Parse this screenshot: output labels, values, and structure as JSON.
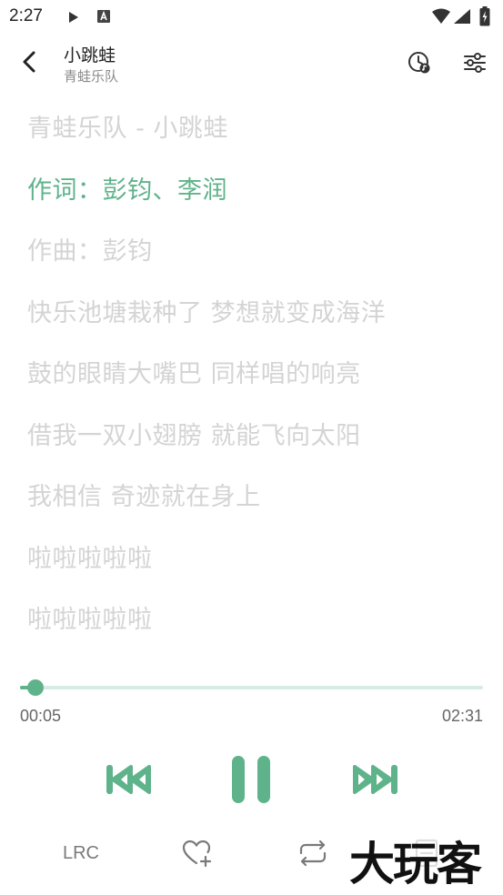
{
  "status_bar": {
    "time": "2:27",
    "icons": [
      "play-notification-icon",
      "a-notification-icon",
      "wifi-icon",
      "cellular-icon",
      "battery-icon"
    ]
  },
  "header": {
    "song_title": "小跳蛙",
    "artist": "青蛙乐队",
    "icons": [
      "back-icon",
      "sleep-timer-icon",
      "equalizer-settings-icon"
    ]
  },
  "lyrics": {
    "active_index": 1,
    "lines": [
      "青蛙乐队 - 小跳蛙",
      "作词：彭钧、李润",
      "作曲：彭钧",
      "快乐池塘栽种了 梦想就变成海洋",
      "鼓的眼睛大嘴巴 同样唱的响亮",
      "借我一双小翅膀 就能飞向太阳",
      "我相信 奇迹就在身上",
      "啦啦啦啦啦",
      "啦啦啦啦啦"
    ]
  },
  "player": {
    "current_time": "00:05",
    "total_time": "02:31",
    "progress_fraction": 0.033
  },
  "controls": {
    "icons": [
      "previous-icon",
      "pause-icon",
      "next-icon"
    ]
  },
  "bottom_bar": {
    "lrc_label": "LRC",
    "icons": [
      "favorite-add-icon",
      "repeat-icon",
      "playlist-icon"
    ]
  },
  "watermark": {
    "text": "大玩客"
  },
  "colors": {
    "accent": "#5fb38a",
    "lyric_inactive": "#d4d4d4",
    "track": "#d8ebe2"
  }
}
